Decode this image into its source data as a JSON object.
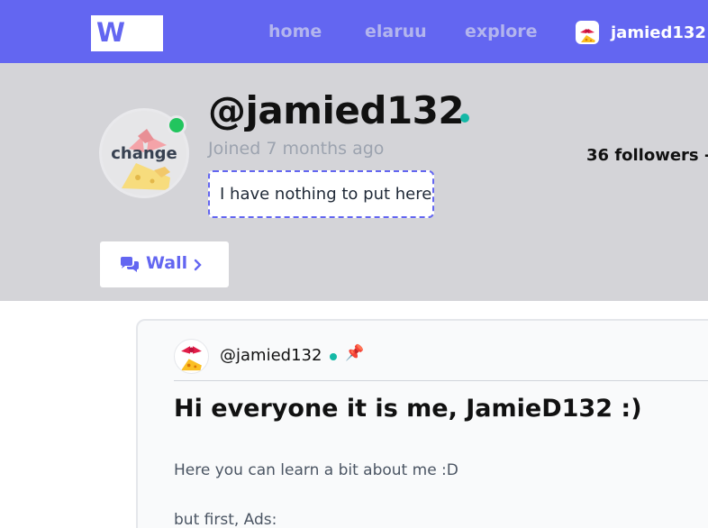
{
  "nav": {
    "logo": "W",
    "links": [
      "home",
      "elaruu",
      "explore"
    ],
    "username": "jamied132",
    "avatar_icon": "bow-cheese-icon"
  },
  "profile": {
    "handle": "@jamied132",
    "joined": "Joined 7 months ago",
    "bio": "I have nothing to put here",
    "avatar_overlay": "change",
    "followers": "36 followers - ",
    "online_status_color": "#22c55e",
    "wall_button": "Wall"
  },
  "post": {
    "author": "@jamied132",
    "title": "Hi everyone it is me, JamieD132 :)",
    "paragraphs": [
      "Here you can learn a bit about me :D",
      "but first, Ads:"
    ],
    "pinned": true
  },
  "colors": {
    "accent": "#6366f1",
    "header_bg": "#d4d4d8",
    "online_dot": "#14b8a6"
  }
}
